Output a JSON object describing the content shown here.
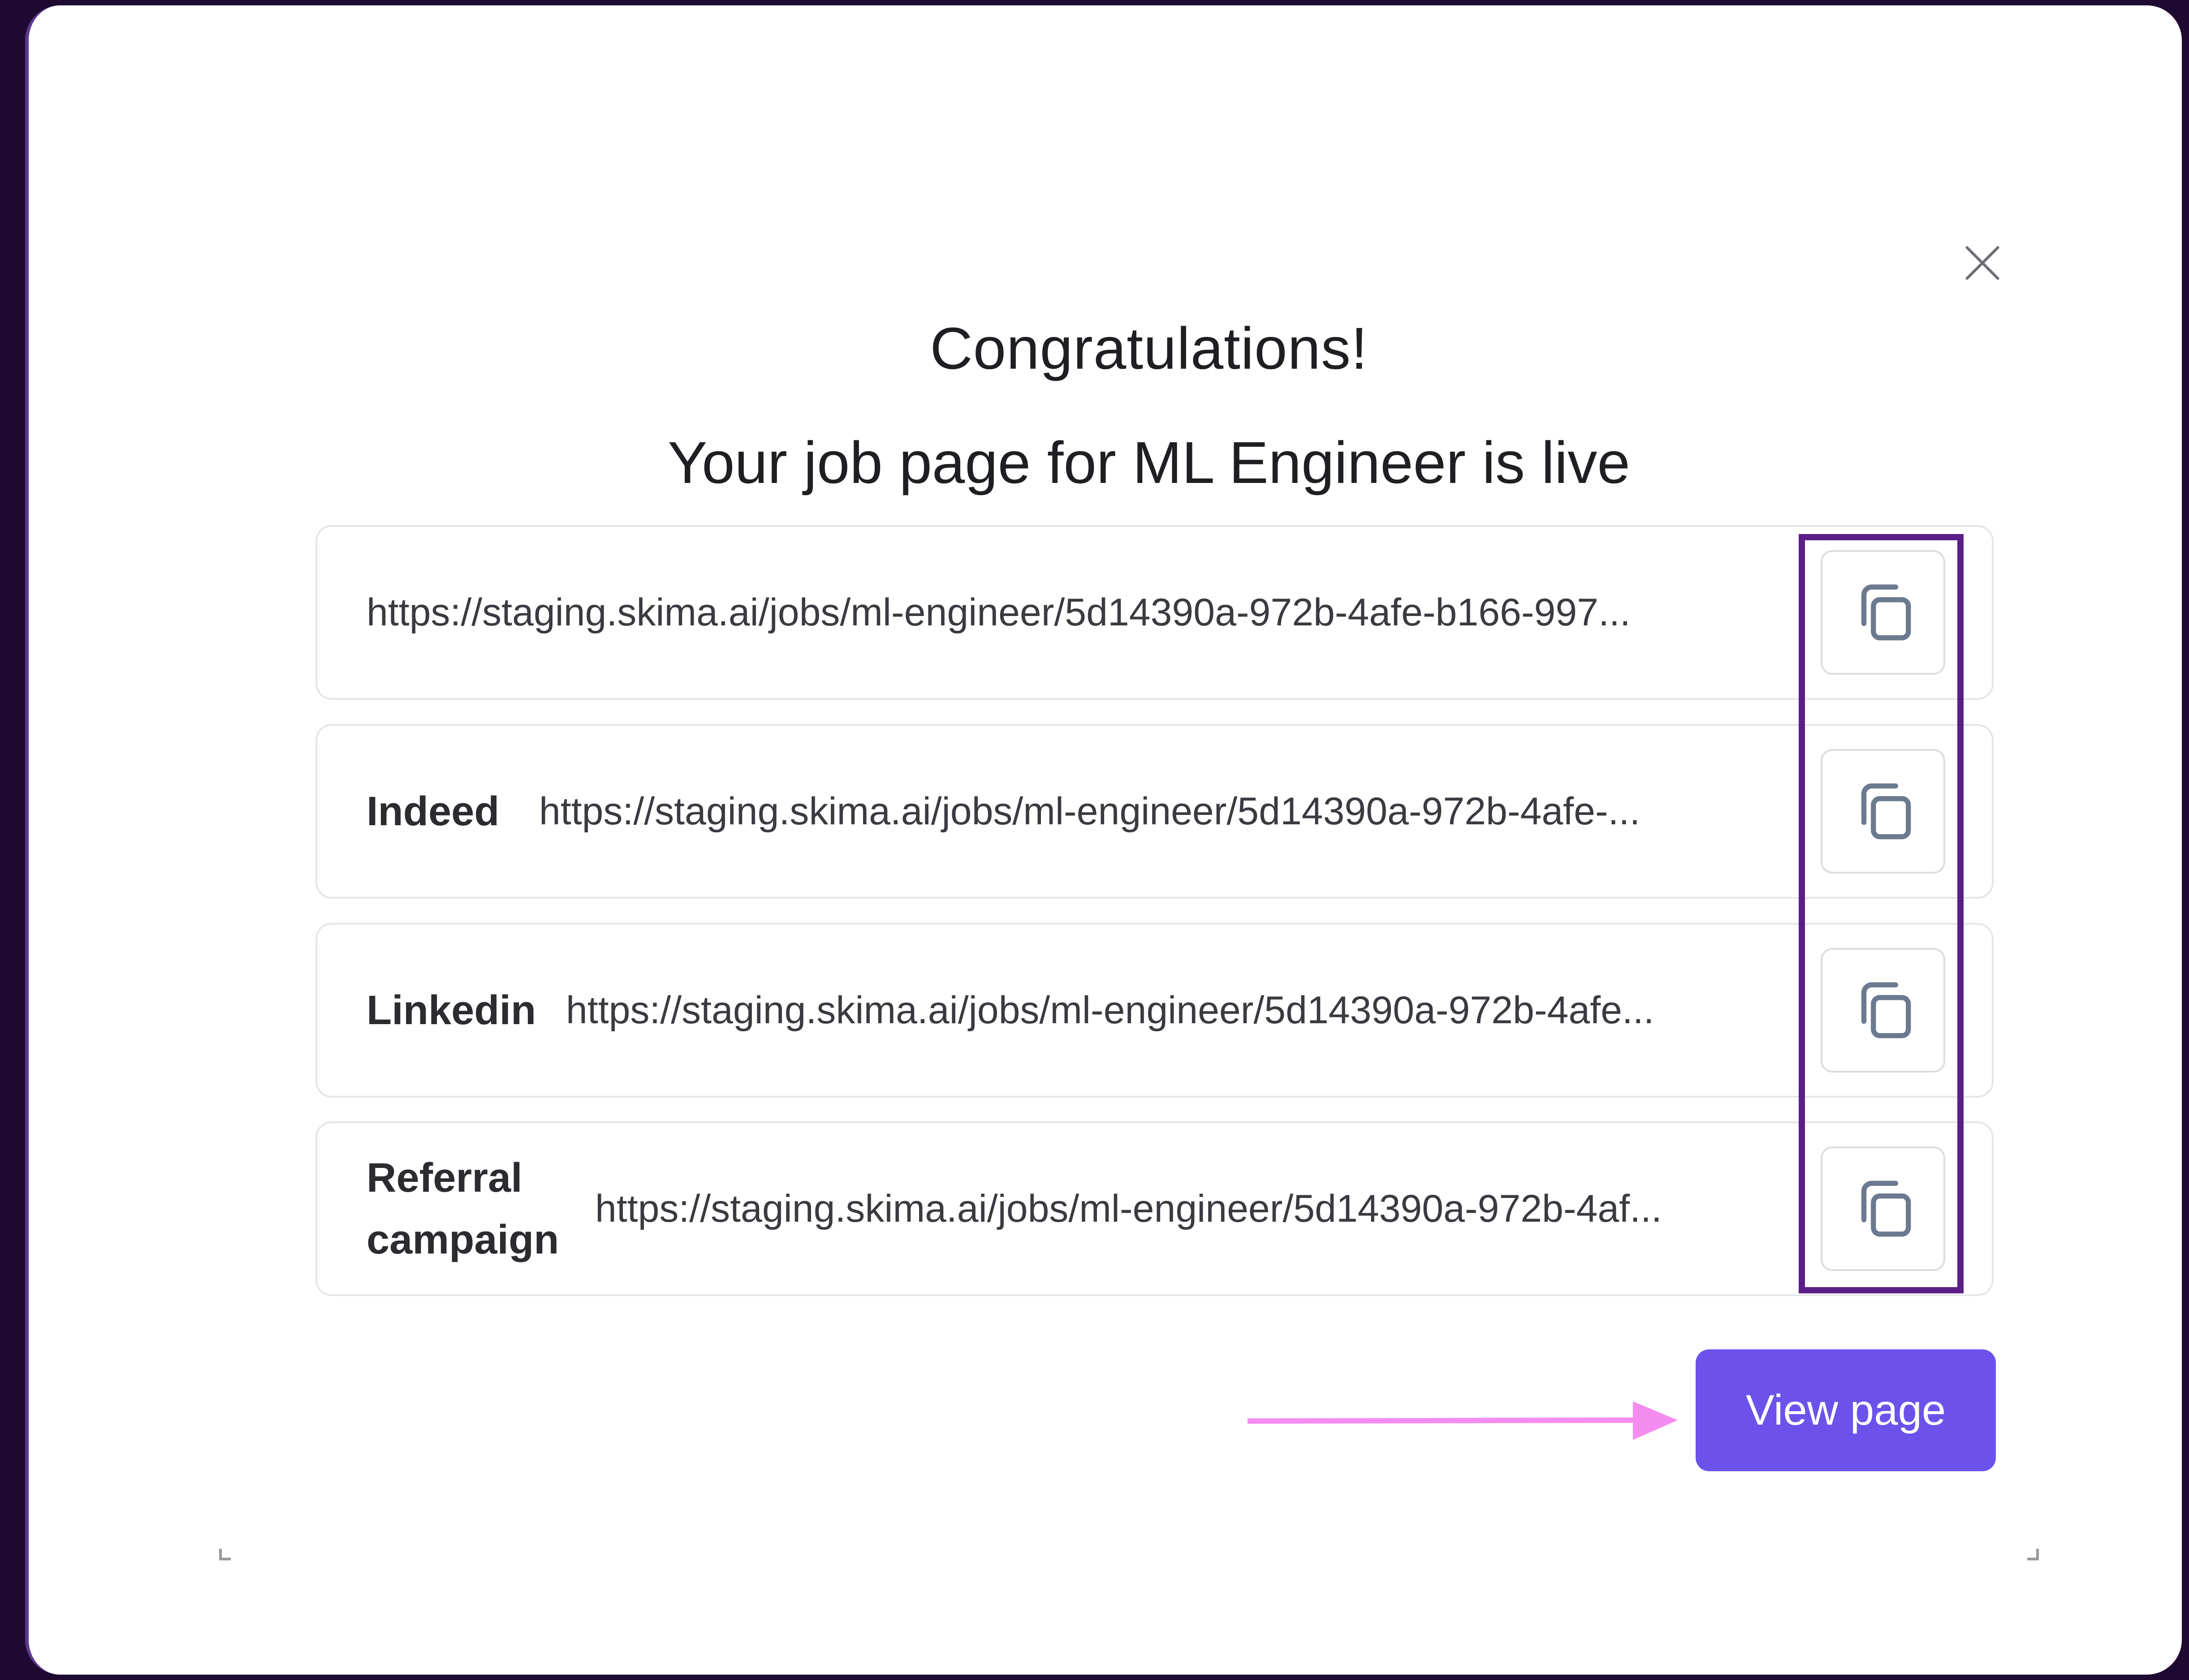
{
  "dialog": {
    "close_label": "close",
    "title": "Congratulations!",
    "subtitle": "Your job page for ML Engineer is live",
    "links": [
      {
        "label": "",
        "url": "https://staging.skima.ai/jobs/ml-engineer/5d14390a-972b-4afe-b166-997..."
      },
      {
        "label": "Indeed",
        "url": "https://staging.skima.ai/jobs/ml-engineer/5d14390a-972b-4afe-..."
      },
      {
        "label": "Linkedin",
        "url": "https://staging.skima.ai/jobs/ml-engineer/5d14390a-972b-4afe..."
      },
      {
        "label": "Referral campaign",
        "url": "https://staging.skima.ai/jobs/ml-engineer/5d14390a-972b-4af..."
      }
    ],
    "copy_icon": "copy-icon",
    "view_button_label": "View page"
  },
  "annotations": {
    "highlight_color": "#5c1f88",
    "arrow_color": "#f58cf0"
  },
  "colors": {
    "primary": "#6c52ea",
    "frame": "#1e0a30"
  }
}
